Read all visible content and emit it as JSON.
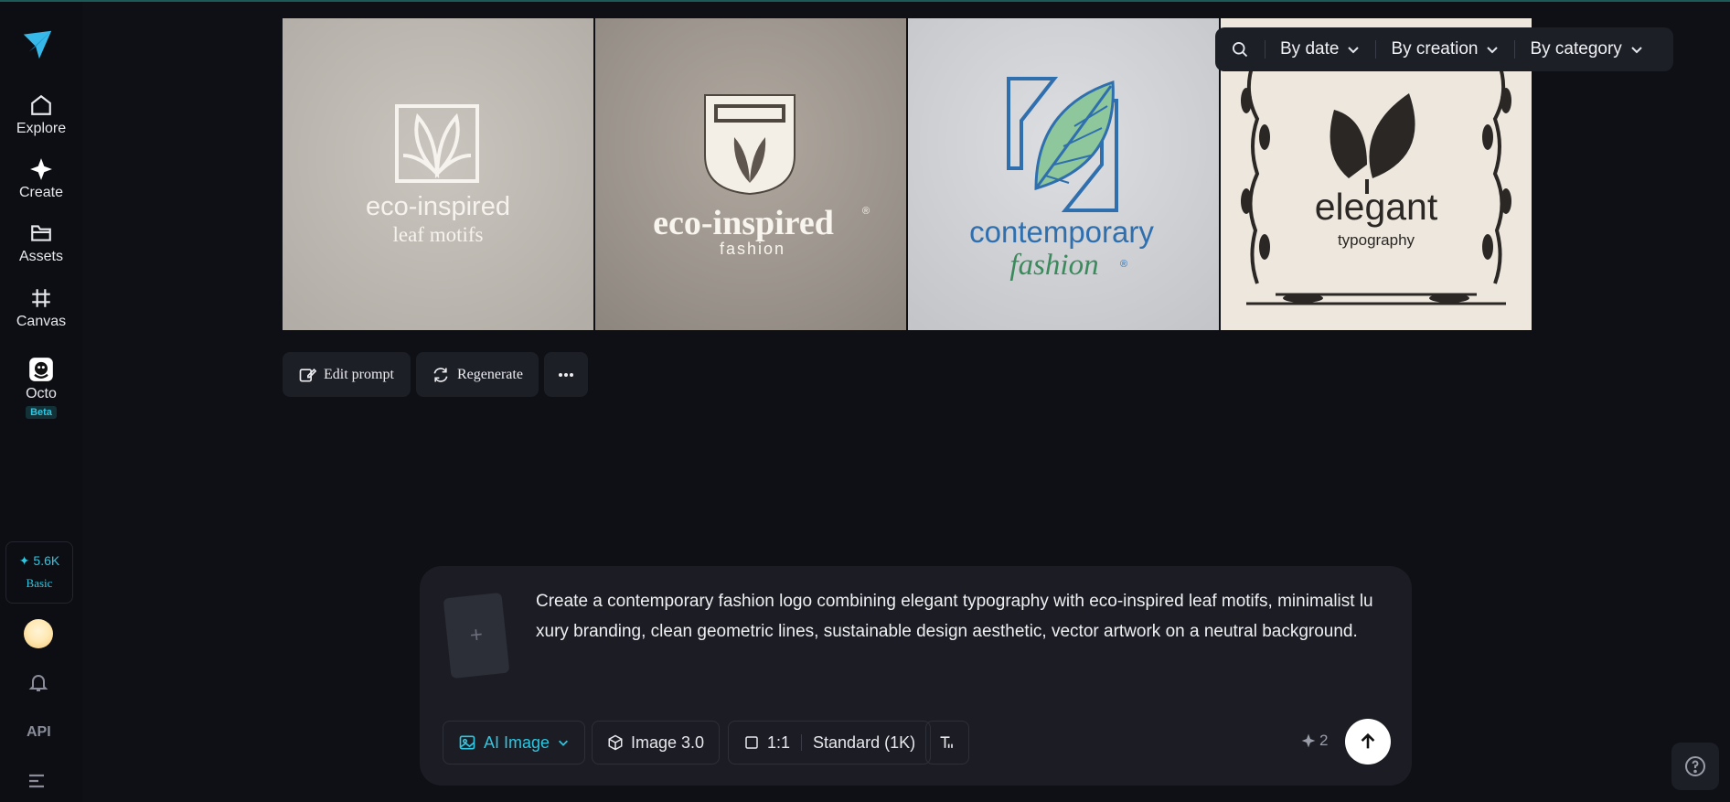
{
  "sidebar": {
    "items": [
      {
        "label": "Explore"
      },
      {
        "label": "Create"
      },
      {
        "label": "Assets"
      },
      {
        "label": "Canvas"
      },
      {
        "label": "Octo",
        "badge": "Beta"
      }
    ],
    "credits": {
      "amount": "✦ 5.6K",
      "plan": "Basic"
    },
    "api_label": "API"
  },
  "gallery": {
    "images": [
      {
        "line1": "eco-inspired",
        "line2": "leaf motifs",
        "bg": "#c4bfb8"
      },
      {
        "line1": "eco-inspired",
        "line2": "fashion",
        "mark": "®",
        "bg": "#a39b93"
      },
      {
        "line1": "contemporary",
        "line2": "fashion",
        "mark": "®",
        "bg": "#d0d2d6"
      },
      {
        "line1": "elegant",
        "line2": "typography",
        "bg": "#ede7de"
      }
    ]
  },
  "filters": {
    "search_icon": "search-icon",
    "items": [
      {
        "label": "By date"
      },
      {
        "label": "By creation"
      },
      {
        "label": "By category"
      }
    ]
  },
  "actions": {
    "edit_prompt": "Edit prompt",
    "regenerate": "Regenerate"
  },
  "composer": {
    "add_symbol": "+",
    "prompt": "Create a contemporary fashion logo combining elegant typography with eco-inspired leaf motifs, minimalist luxury branding, clean geometric lines, sustainable design aesthetic, vector artwork on a neutral background.",
    "mode": "AI Image",
    "model": "Image 3.0",
    "ratio": "1:1",
    "quality": "Standard (1K)",
    "cost": "2"
  },
  "colors": {
    "accent": "#2ec6e0",
    "background": "#0f1016",
    "panel": "#1c1d24"
  }
}
